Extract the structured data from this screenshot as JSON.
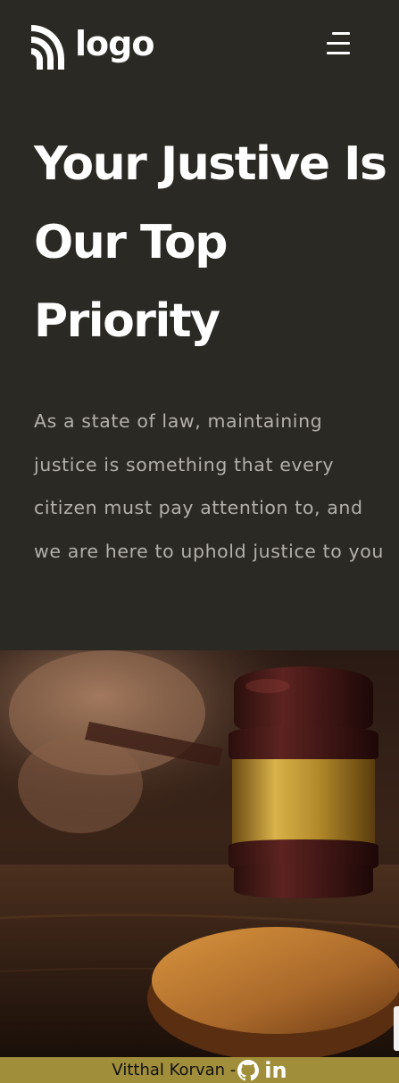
{
  "header": {
    "logo_text": "logo",
    "logo_icon": "logo-mark-icon",
    "menu_icon": "hamburger-menu-icon"
  },
  "hero": {
    "title_lines": [
      "Your Justive Is",
      "Our Top",
      "Priority"
    ],
    "description": "As a state of law, maintaining justice is something that every citizen must pay attention to, and we are here to uphold justice to you",
    "image": "judge-gavel-photo"
  },
  "footer": {
    "credit": "Vitthal Korvan -",
    "github_icon": "github-icon",
    "linkedin_label": "in"
  },
  "colors": {
    "background": "#2b2924",
    "title": "#ffffff",
    "description": "#b3b0a9",
    "footer_bg": "#a08e3a"
  }
}
